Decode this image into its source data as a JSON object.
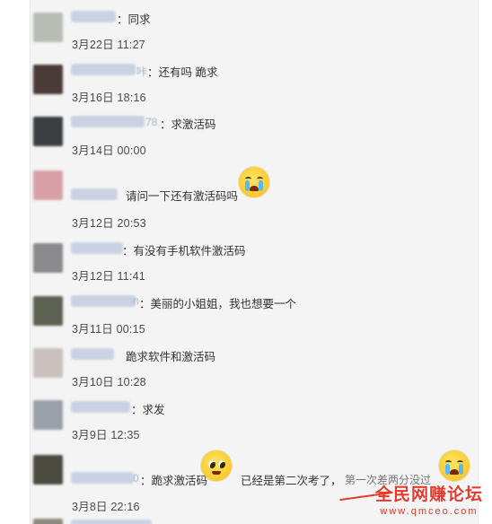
{
  "comments": [
    {
      "nick_tail": "",
      "text": "：同求",
      "date": "3月22日 11:27",
      "avatar_color": "#b8bcb4"
    },
    {
      "nick_tail": "咔",
      "text": "：还有吗 跪求",
      "date": "3月16日 18:16",
      "avatar_color": "#4a3b38"
    },
    {
      "nick_tail": "78",
      "text": "：求激活码",
      "date": "3月14日 00:00",
      "avatar_color": "#3b3f41"
    },
    {
      "nick_tail": "",
      "text": "请问一下还有激活码吗",
      "date": "3月12日 20:53",
      "avatar_color": "#d8a0a6"
    },
    {
      "nick_tail": "",
      "text": "：有没有手机软件激活码",
      "date": "3月12日 11:41",
      "avatar_color": "#8a8a8c"
    },
    {
      "nick_tail": "n",
      "text": "：美丽的小姐姐，我也想要一个",
      "date": "3月11日 00:15",
      "avatar_color": "#5d6152"
    },
    {
      "nick_tail": "",
      "text": "跪求软件和激活码",
      "date": "3月10日 10:28",
      "avatar_color": "#c9c0bd"
    },
    {
      "nick_tail": "",
      "text": "：求发",
      "date": "3月9日 12:35",
      "avatar_color": "#9aa0a8"
    },
    {
      "nick_tail": "0",
      "text": "：跪求激活码",
      "text2": "已经是第二次考了，",
      "text3": "第一次差两分没过",
      "date": "3月8日 22:16",
      "avatar_color": "#4a4b3e"
    }
  ],
  "watermark": {
    "title": "全民网赚论坛",
    "url": "www.qmceo.com"
  }
}
